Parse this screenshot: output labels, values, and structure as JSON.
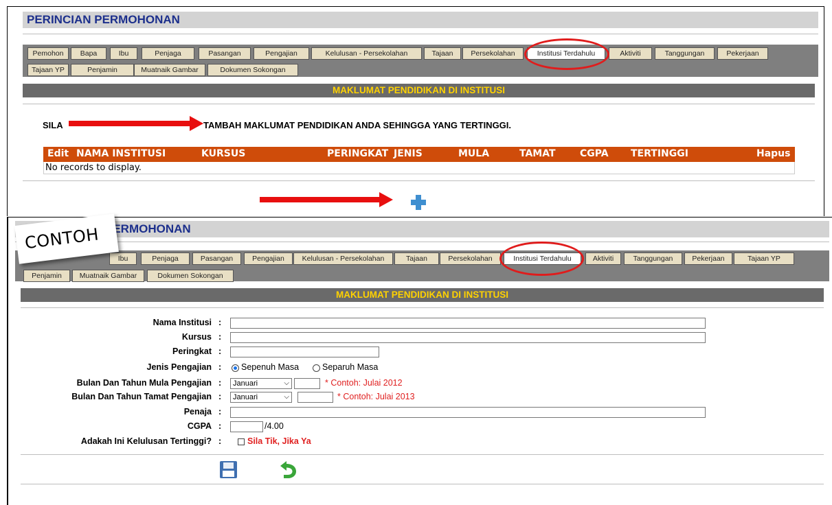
{
  "screen1": {
    "title": "PERINCIAN PERMOHONAN",
    "tabs_row1": [
      "Pemohon",
      "Bapa",
      "Ibu",
      "Penjaga",
      "Pasangan",
      "Pengajian",
      "Kelulusan - Persekolahan",
      "Tajaan",
      "Persekolahan",
      "Institusi Terdahulu",
      "Aktiviti",
      "Tanggungan",
      "Pekerjaan"
    ],
    "tabs_row2": [
      "Tajaan YP",
      "Penjamin",
      "Muatnaik Gambar",
      "Dokumen Sokongan"
    ],
    "active_tab": "Institusi Terdahulu",
    "section_title": "MAKLUMAT PENDIDIKAN DI INSTITUSI",
    "instruction_start": "SILA",
    "instruction_end": "TAMBAH MAKLUMAT PENDIDIKAN ANDA SEHINGGA YANG TERTINGGI.",
    "grid": {
      "columns": [
        "Edit",
        "NAMA INSTITUSI",
        "KURSUS",
        "PERINGKAT",
        "JENIS",
        "MULA",
        "TAMAT",
        "CGPA",
        "TERTINGGI",
        "Hapus"
      ],
      "empty_text": "No records to display."
    },
    "add_icon": "plus-icon"
  },
  "screen2": {
    "stamp": "CONTOH",
    "title": "PERMOHONAN",
    "tabs_row1": [
      "Ibu",
      "Penjaga",
      "Pasangan",
      "Pengajian",
      "Kelulusan - Persekolahan",
      "Tajaan",
      "Persekolahan",
      "Institusi Terdahulu",
      "Aktiviti",
      "Tanggungan",
      "Pekerjaan",
      "Tajaan YP"
    ],
    "tabs_row2": [
      "Penjamin",
      "Muatnaik Gambar",
      "Dokumen Sokongan"
    ],
    "active_tab": "Institusi Terdahulu",
    "section_title": "MAKLUMAT PENDIDIKAN DI INSTITUSI",
    "form": {
      "nama_institusi_label": "Nama Institusi",
      "kursus_label": "Kursus",
      "peringkat_label": "Peringkat",
      "jenis_label": "Jenis Pengajian",
      "jenis_option1": "Sepenuh Masa",
      "jenis_option2": "Separuh Masa",
      "mula_label": "Bulan Dan Tahun Mula Pengajian",
      "mula_month": "Januari",
      "mula_hint": "* Contoh: Julai 2012",
      "tamat_label": "Bulan Dan Tahun Tamat Pengajian",
      "tamat_month": "Januari",
      "tamat_hint": "* Contoh: Julai 2013",
      "penaja_label": "Penaja",
      "cgpa_label": "CGPA",
      "cgpa_suffix": "/4.00",
      "tertinggi_label": "Adakah Ini Kelulusan Tertinggi?",
      "tertinggi_hint": "Sila Tik, Jika Ya",
      "colon": ":"
    },
    "save_icon": "save-icon",
    "back_icon": "undo-icon"
  },
  "colors": {
    "title_text": "#1c2f8c",
    "section_text": "#ffd200",
    "grid_header": "#cf4c0a",
    "annotation_red": "#e80f0f"
  }
}
